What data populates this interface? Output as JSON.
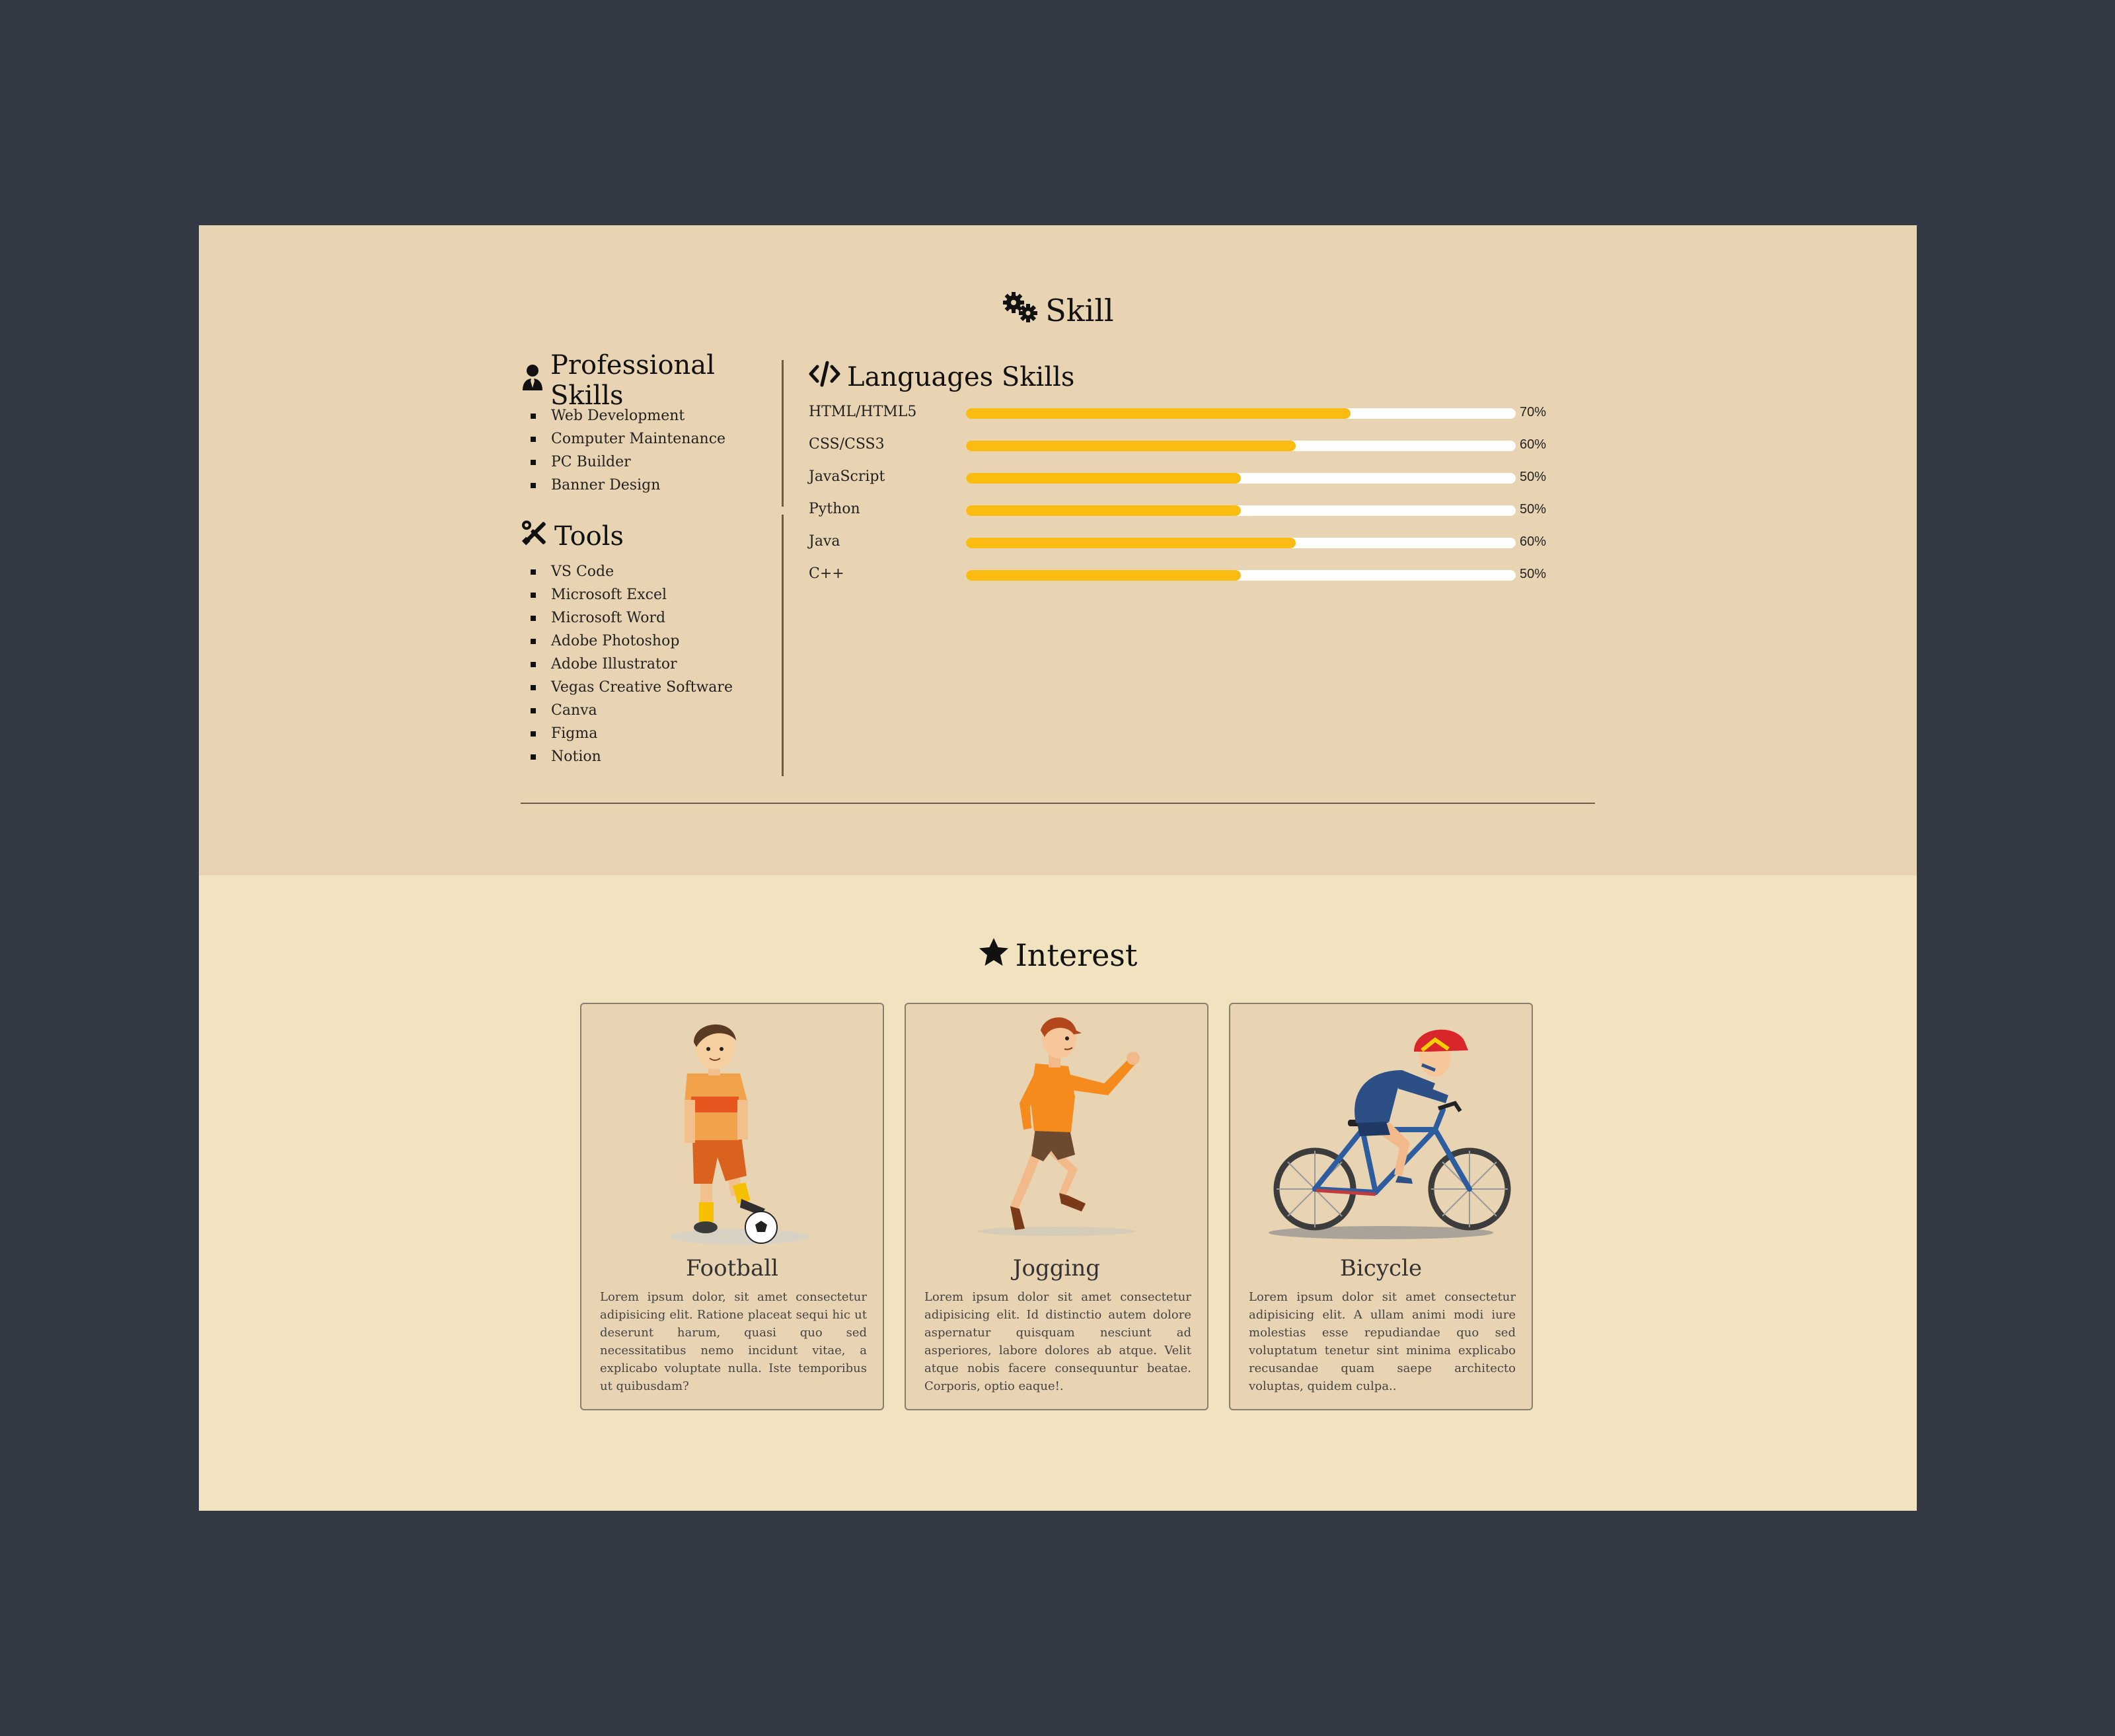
{
  "skill": {
    "title": "Skill",
    "icon": "gears-icon",
    "professional": {
      "heading": "Professional Skills",
      "icon": "user-tie-icon",
      "items": [
        "Web Development",
        "Computer Maintenance",
        "PC Builder",
        "Banner Design"
      ]
    },
    "tools": {
      "heading": "Tools",
      "icon": "tools-icon",
      "items": [
        "VS Code",
        "Microsoft Excel",
        "Microsoft Word",
        "Adobe Photoshop",
        "Adobe Illustrator",
        "Vegas Creative Software",
        "Canva",
        "Figma",
        "Notion"
      ]
    },
    "languages": {
      "heading": "Languages Skills",
      "icon": "code-icon",
      "bar_color": "#fbbc12",
      "items": [
        {
          "name": "HTML/HTML5",
          "percent": 70,
          "label": "70%"
        },
        {
          "name": "CSS/CSS3",
          "percent": 60,
          "label": "60%"
        },
        {
          "name": "JavaScript",
          "percent": 50,
          "label": "50%"
        },
        {
          "name": "Python",
          "percent": 50,
          "label": "50%"
        },
        {
          "name": "Java",
          "percent": 60,
          "label": "60%"
        },
        {
          "name": "C++",
          "percent": 50,
          "label": "50%"
        }
      ]
    }
  },
  "interest": {
    "title": "Interest",
    "icon": "star-icon",
    "cards": [
      {
        "title": "Football",
        "illustration": "football-player-illustration",
        "text": "Lorem ipsum dolor, sit amet consectetur adipisicing elit. Ratione placeat sequi hic ut deserunt harum, quasi quo sed necessitatibus nemo incidunt vitae, a explicabo voluptate nulla. Iste temporibus ut quibusdam?"
      },
      {
        "title": "Jogging",
        "illustration": "jogger-illustration",
        "text": "Lorem ipsum dolor sit amet consectetur adipisicing elit. Id distinctio autem dolore aspernatur quisquam nesciunt ad asperiores, labore dolores ab atque. Velit atque nobis facere consequuntur beatae. Corporis, optio eaque!."
      },
      {
        "title": "Bicycle",
        "illustration": "cyclist-illustration",
        "text": "Lorem ipsum dolor sit amet consectetur adipisicing elit. A ullam animi modi iure molestias esse repudiandae quo sed voluptatum tenetur sint minima explicabo recusandae quam saepe architecto voluptas, quidem culpa.."
      }
    ]
  }
}
